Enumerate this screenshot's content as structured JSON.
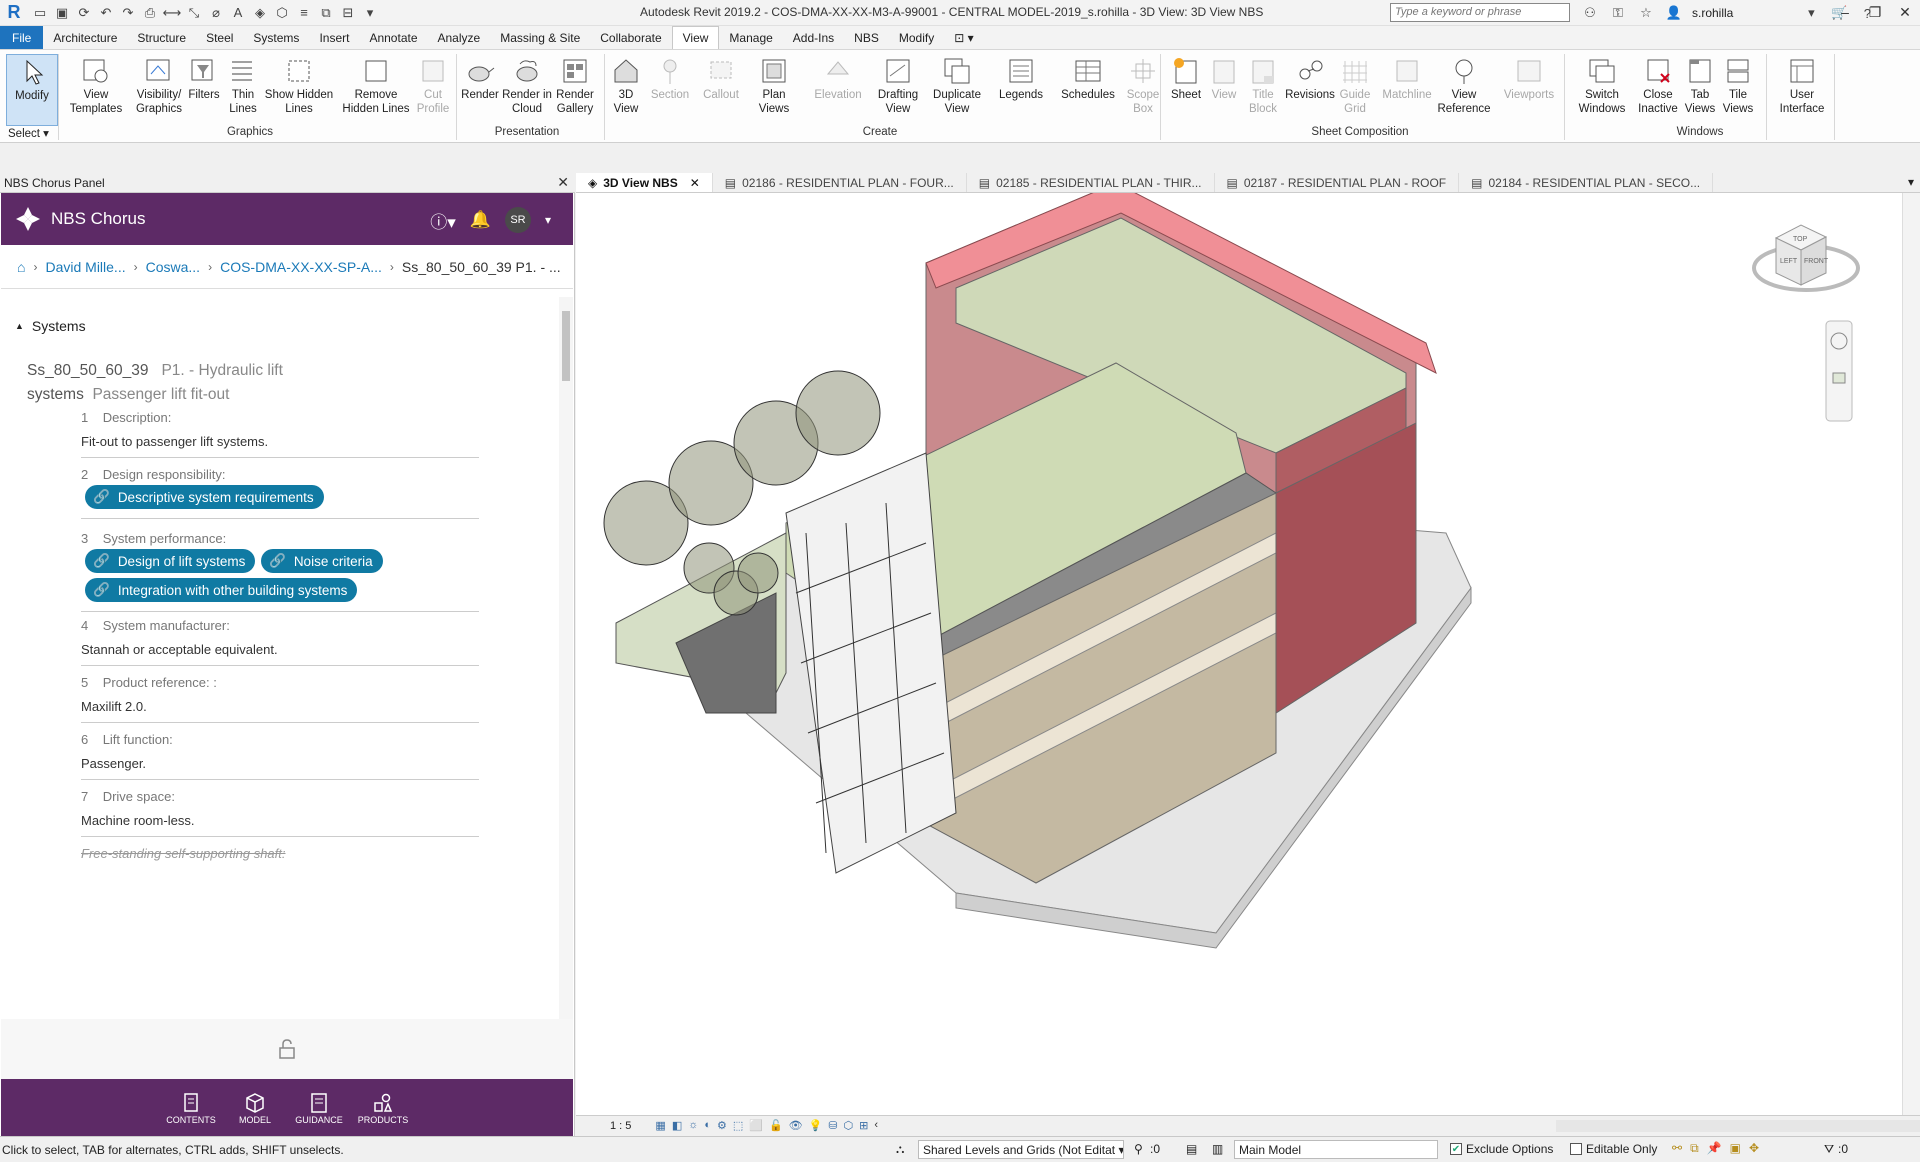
{
  "window": {
    "title": "Autodesk Revit 2019.2 - COS-DMA-XX-XX-M3-A-99001 - CENTRAL MODEL-2019_s.rohilla - 3D View: 3D View  NBS",
    "search_placeholder": "Type a keyword or phrase",
    "user": "s.rohilla"
  },
  "ribbon_tabs": [
    "File",
    "Architecture",
    "Structure",
    "Steel",
    "Systems",
    "Insert",
    "Annotate",
    "Analyze",
    "Massing & Site",
    "Collaborate",
    "View",
    "Manage",
    "Add-Ins",
    "NBS",
    "Modify"
  ],
  "active_ribbon_tab": "View",
  "ribbon": {
    "modify": "Modify",
    "select": "Select",
    "buttons": {
      "view_templates": "View Templates",
      "visibility_graphics": "Visibility/ Graphics",
      "filters": "Filters",
      "thin_lines": "Thin Lines",
      "show_hidden_lines": "Show Hidden Lines",
      "remove_hidden_lines": "Remove Hidden Lines",
      "cut_profile": "Cut Profile",
      "render": "Render",
      "render_in_cloud": "Render in Cloud",
      "render_gallery": "Render Gallery",
      "view_3d": "3D View",
      "section": "Section",
      "callout": "Callout",
      "plan_views": "Plan Views",
      "elevation": "Elevation",
      "drafting_view": "Drafting View",
      "duplicate_view": "Duplicate View",
      "legends": "Legends",
      "schedules": "Schedules",
      "scope_box": "Scope Box",
      "sheet": "Sheet",
      "view": "View",
      "title_block": "Title Block",
      "revisions": "Revisions",
      "guide_grid": "Guide Grid",
      "matchline": "Matchline",
      "view_reference": "View Reference",
      "viewports": "Viewports",
      "switch_windows": "Switch Windows",
      "close_inactive": "Close Inactive",
      "tab_views": "Tab Views",
      "tile_views": "Tile Views",
      "user_interface": "User Interface"
    },
    "panels": {
      "graphics": "Graphics",
      "presentation": "Presentation",
      "create": "Create",
      "sheet_composition": "Sheet Composition",
      "windows": "Windows"
    }
  },
  "nbs": {
    "panel_title": "NBS Chorus Panel",
    "brand": "NBS Chorus",
    "avatar_initials": "SR",
    "breadcrumb": [
      "David Mille...",
      "Coswa...",
      "COS-DMA-XX-XX-SP-A...",
      "Ss_80_50_60_39 P1. - ..."
    ],
    "section": "Systems",
    "clause": {
      "code": "Ss_80_50_60_39",
      "title_part1": "P1. - Hydraulic lift",
      "title_part2": "systems",
      "subtitle": "Passenger lift fit-out"
    },
    "properties": [
      {
        "num": "1",
        "label": "Description:",
        "value": "Fit-out to passenger lift systems."
      },
      {
        "num": "2",
        "label": "Design responsibility:",
        "tags": [
          "Descriptive system requirements"
        ]
      },
      {
        "num": "3",
        "label": "System performance:",
        "tags": [
          "Design of lift systems",
          "Noise criteria",
          "Integration with other building systems"
        ]
      },
      {
        "num": "4",
        "label": "System manufacturer:",
        "value": "Stannah or acceptable equivalent."
      },
      {
        "num": "5",
        "label": "Product reference: :",
        "value": "Maxilift 2.0."
      },
      {
        "num": "6",
        "label": "Lift function:",
        "value": "Passenger."
      },
      {
        "num": "7",
        "label": "Drive space:",
        "value": "Machine room-less."
      }
    ],
    "struck_text": "Free-standing self-supporting shaft:",
    "bottom_nav": [
      "CONTENTS",
      "MODEL",
      "GUIDANCE",
      "PRODUCTS"
    ]
  },
  "view_tabs": [
    {
      "label": "3D View  NBS",
      "active": true
    },
    {
      "label": "02186 - RESIDENTIAL PLAN - FOUR...",
      "active": false
    },
    {
      "label": "02185 - RESIDENTIAL PLAN - THIR...",
      "active": false
    },
    {
      "label": "02187 - RESIDENTIAL PLAN - ROOF",
      "active": false
    },
    {
      "label": "02184 - RESIDENTIAL PLAN - SECO...",
      "active": false
    }
  ],
  "view_control": {
    "scale": "1 : 5"
  },
  "viewcube": {
    "top": "TOP",
    "left": "LEFT",
    "front": "FRONT"
  },
  "status": {
    "message": "Click to select, TAB for alternates, CTRL adds, SHIFT unselects.",
    "workset": "Shared Levels and Grids (Not Editat",
    "count": ":0",
    "model": "Main Model",
    "exclude_options": "Exclude Options",
    "editable_only": "Editable Only",
    "filter_count": ":0"
  },
  "colors": {
    "nbs_purple": "#5d2a66",
    "tag_teal": "#107aa3",
    "link_blue": "#1b7ab8",
    "file_tab_blue": "#1e73be"
  }
}
